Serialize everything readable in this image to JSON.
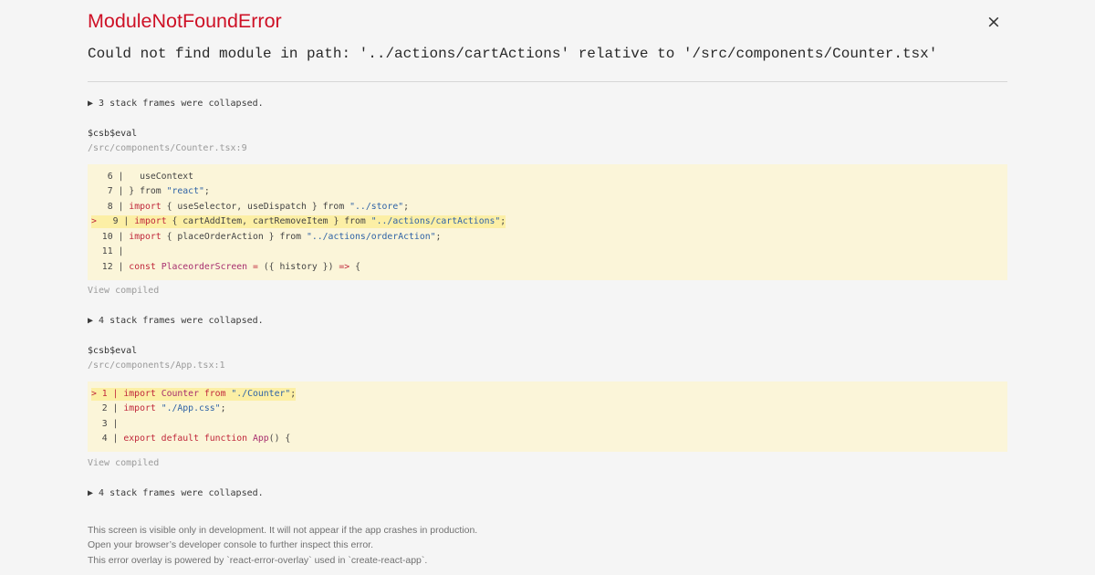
{
  "error": {
    "title": "ModuleNotFoundError",
    "message": "Could not find module in path: '../actions/cartActions' relative to '/src/components/Counter.tsx'",
    "close_label": "×"
  },
  "collapsed": [
    "▶ 3 stack frames were collapsed.",
    "▶ 4 stack frames were collapsed.",
    "▶ 4 stack frames were collapsed."
  ],
  "frames": [
    {
      "function": "$csb$eval",
      "location": "/src/components/Counter.tsx:9",
      "view_compiled": "View compiled",
      "lines": [
        {
          "highlight": false,
          "segments": [
            [
              "g",
              "   6 |   useContext"
            ]
          ]
        },
        {
          "highlight": false,
          "segments": [
            [
              "g",
              "   7 | } from "
            ],
            [
              "s",
              "\"react\""
            ],
            [
              "g",
              ";"
            ]
          ]
        },
        {
          "highlight": false,
          "segments": [
            [
              "g",
              "   8 | "
            ],
            [
              "k",
              "import"
            ],
            [
              "g",
              " { useSelector, useDispatch } from "
            ],
            [
              "s",
              "\"../store\""
            ],
            [
              "g",
              ";"
            ]
          ]
        },
        {
          "highlight": true,
          "segments": [
            [
              "k",
              ">"
            ],
            [
              "g",
              "   9 | "
            ],
            [
              "k",
              "import"
            ],
            [
              "g",
              " { cartAddItem, cartRemoveItem } from "
            ],
            [
              "s",
              "\"../actions/cartActions\""
            ],
            [
              "g",
              ";"
            ]
          ]
        },
        {
          "highlight": false,
          "segments": [
            [
              "g",
              "  10 | "
            ],
            [
              "k",
              "import"
            ],
            [
              "g",
              " { placeOrderAction } from "
            ],
            [
              "s",
              "\"../actions/orderAction\""
            ],
            [
              "g",
              ";"
            ]
          ]
        },
        {
          "highlight": false,
          "segments": [
            [
              "g",
              "  11 |"
            ]
          ]
        },
        {
          "highlight": false,
          "segments": [
            [
              "g",
              "  12 | "
            ],
            [
              "k",
              "const"
            ],
            [
              "g",
              " "
            ],
            [
              "v",
              "PlaceorderScreen"
            ],
            [
              "g",
              " "
            ],
            [
              "k",
              "="
            ],
            [
              "g",
              " ({ history }) "
            ],
            [
              "k",
              "=>"
            ],
            [
              "g",
              " {"
            ]
          ]
        }
      ]
    },
    {
      "function": "$csb$eval",
      "location": "/src/components/App.tsx:1",
      "view_compiled": "View compiled",
      "lines": [
        {
          "highlight": true,
          "segments": [
            [
              "k",
              "> 1 | import"
            ],
            [
              "g",
              " "
            ],
            [
              "v",
              "Counter"
            ],
            [
              "g",
              " "
            ],
            [
              "k",
              "from"
            ],
            [
              "g",
              " "
            ],
            [
              "s",
              "\"./Counter\""
            ],
            [
              "g",
              ";"
            ]
          ]
        },
        {
          "highlight": false,
          "segments": [
            [
              "g",
              "  2 | "
            ],
            [
              "k",
              "import"
            ],
            [
              "g",
              " "
            ],
            [
              "s",
              "\"./App.css\""
            ],
            [
              "g",
              ";"
            ]
          ]
        },
        {
          "highlight": false,
          "segments": [
            [
              "g",
              "  3 |"
            ]
          ]
        },
        {
          "highlight": false,
          "segments": [
            [
              "g",
              "  4 | "
            ],
            [
              "k",
              "export default function"
            ],
            [
              "g",
              " "
            ],
            [
              "v",
              "App"
            ],
            [
              "g",
              "() {"
            ]
          ]
        }
      ]
    }
  ],
  "footer": [
    "This screen is visible only in development. It will not appear if the app crashes in production.",
    "Open your browser’s developer console to further inspect this error.",
    "This error overlay is powered by `react-error-overlay` used in `create-react-app`."
  ]
}
